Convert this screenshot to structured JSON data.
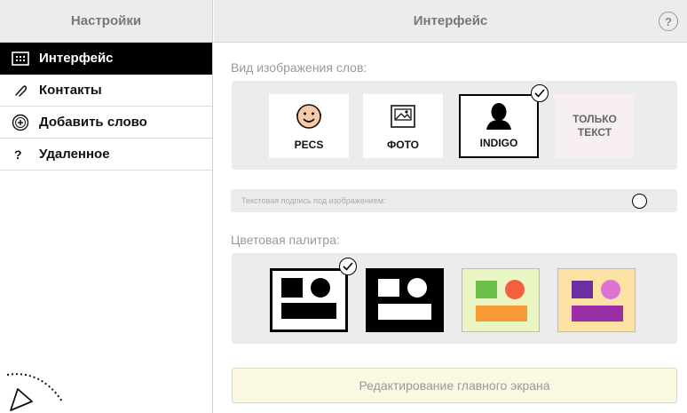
{
  "sidebar": {
    "title": "Настройки",
    "items": [
      {
        "label": "Интерфейс",
        "icon": "grid-icon",
        "active": true
      },
      {
        "label": "Контакты",
        "icon": "paperclip-icon"
      },
      {
        "label": "Добавить слово",
        "icon": "add-circle-icon"
      },
      {
        "label": "Удаленное",
        "icon": "question-icon"
      }
    ]
  },
  "main": {
    "title": "Интерфейс",
    "help_label": "?",
    "word_view": {
      "label": "Вид изображения слов:",
      "options": [
        {
          "label": "PECS",
          "icon": "face-icon"
        },
        {
          "label": "ФОТО",
          "icon": "photo-icon"
        },
        {
          "label": "INDIGO",
          "icon": "silhouette-icon",
          "selected": true
        },
        {
          "line1": "ТОЛЬКО",
          "line2": "ТЕКСТ"
        }
      ]
    },
    "caption_toggle": {
      "label": "Текстовая подпись под изображением:"
    },
    "palette": {
      "label": "Цветовая палитра:",
      "options": [
        {
          "name": "black-on-white",
          "bg": "#ffffff",
          "fg": "#000000",
          "selected": true
        },
        {
          "name": "white-on-black",
          "bg": "#000000",
          "fg": "#ffffff"
        },
        {
          "name": "green-orange",
          "bg": "#e9f5c2",
          "square": "#6cc04a",
          "circle": "#f4603c",
          "bar": "#f89b34"
        },
        {
          "name": "purple-pink",
          "bg": "#fce3a3",
          "square": "#6b2fa0",
          "circle": "#de73d4",
          "bar": "#9b2fa8"
        }
      ]
    },
    "edit_button": "Редактирование главного экрана"
  },
  "colors": {
    "header_bg": "#ececec",
    "active_item_bg": "#000000",
    "panel_bg": "#ececec",
    "edit_button_bg": "#fbf8e2"
  }
}
